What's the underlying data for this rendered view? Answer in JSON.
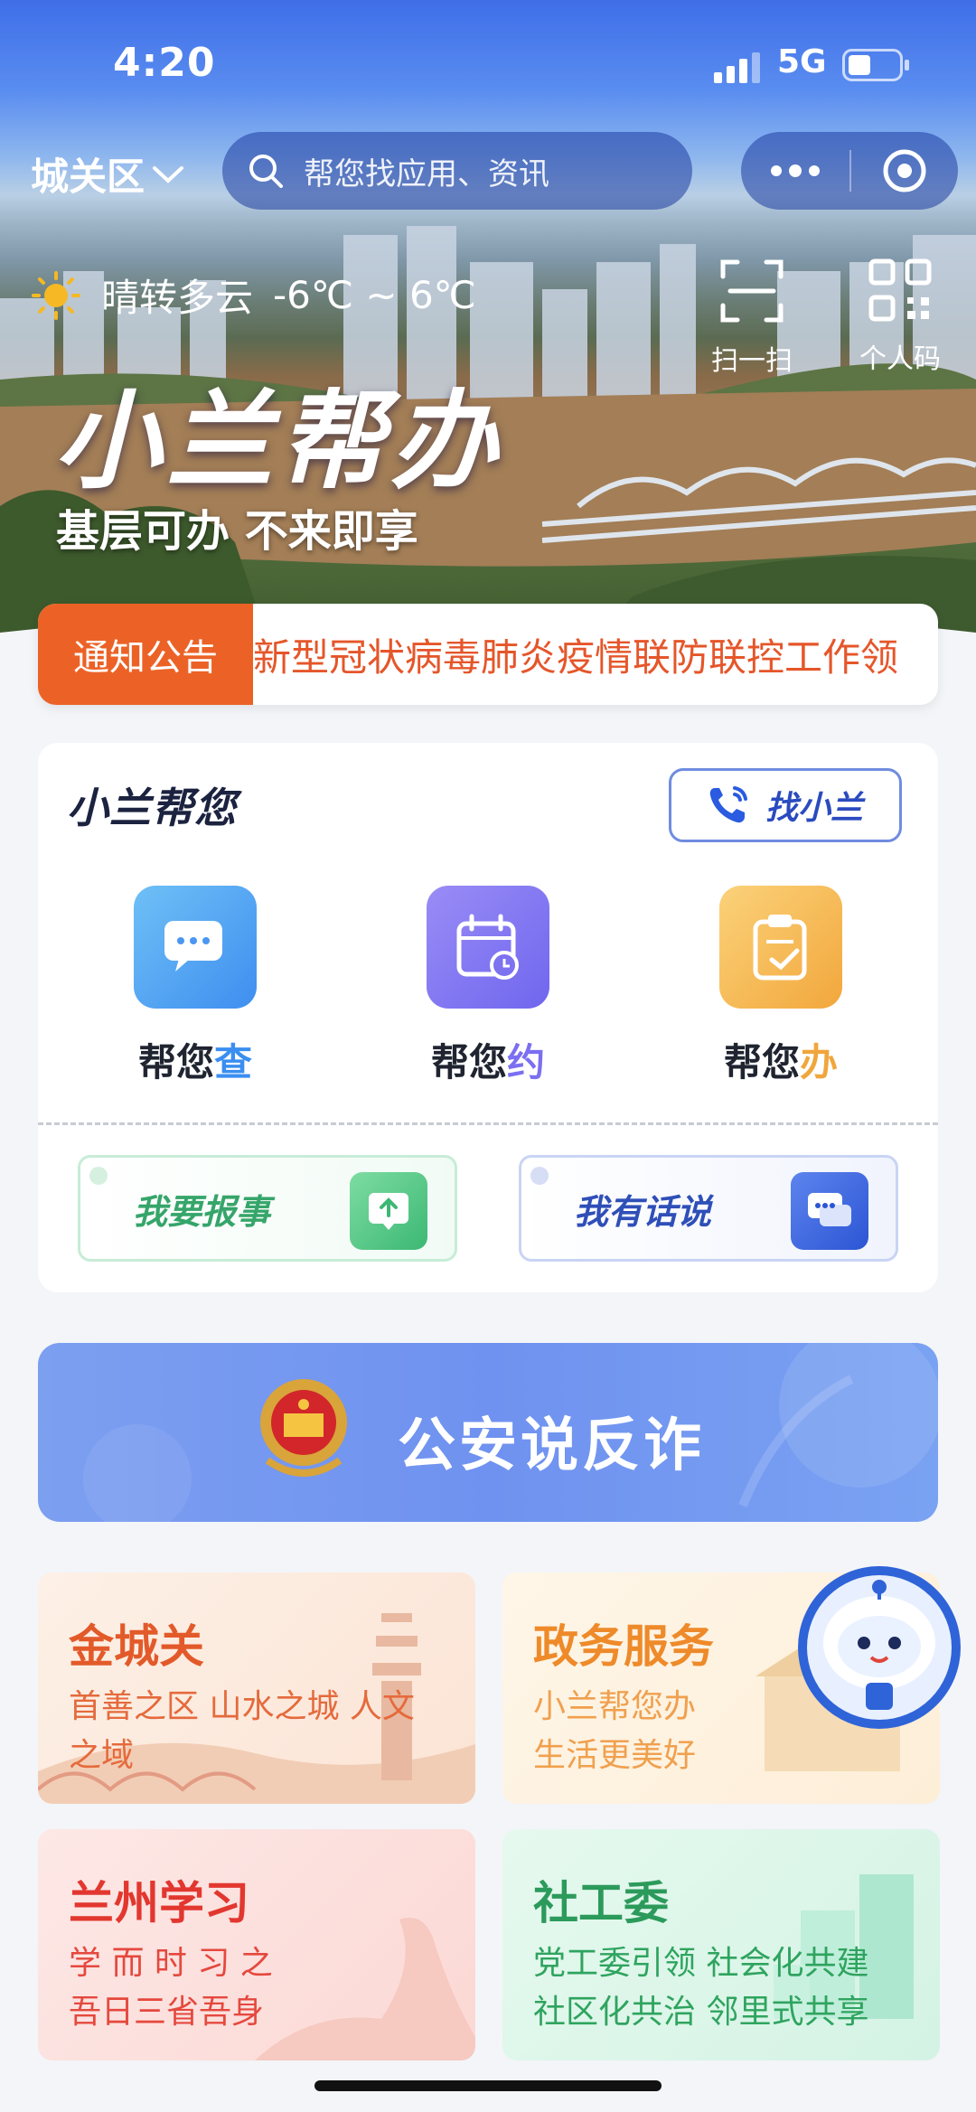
{
  "status": {
    "time": "4:20",
    "network": "5G"
  },
  "topbar": {
    "district": "城关区",
    "search_placeholder": "帮您找应用、资讯"
  },
  "weather": {
    "text": "晴转多云",
    "temperature": "-6℃ ~ 6℃"
  },
  "quick_actions": [
    {
      "label": "扫一扫",
      "icon": "scan-icon"
    },
    {
      "label": "个人码",
      "icon": "qrcode-icon"
    }
  ],
  "hero": {
    "slogan_title": "小兰帮办",
    "slogan_sub": "基层可办 不来即享"
  },
  "notice": {
    "tag": "通知公告",
    "text": "新型冠状病毒肺炎疫情联防联控工作领"
  },
  "help": {
    "title": "小兰帮您",
    "find_button": "找小兰",
    "services": [
      {
        "prefix": "帮您",
        "accent": "查",
        "accent_color": "#3a8ef0"
      },
      {
        "prefix": "帮您",
        "accent": "约",
        "accent_color": "#7b6ff2"
      },
      {
        "prefix": "帮您",
        "accent": "办",
        "accent_color": "#f0a63c"
      }
    ],
    "actions": [
      {
        "label": "我要报事",
        "icon": "upload-icon"
      },
      {
        "label": "我有话说",
        "icon": "chat-icon"
      }
    ]
  },
  "banner": {
    "text": "公安说反诈"
  },
  "tiles": [
    {
      "title": "金城关",
      "subtitle_line1": "首善之区 山水之城 人文",
      "subtitle_line2": "之域"
    },
    {
      "title": "政务服务",
      "subtitle_line1": "小兰帮您办",
      "subtitle_line2": "生活更美好"
    },
    {
      "title": "兰州学习",
      "subtitle_line1": "学 而 时 习 之",
      "subtitle_line2": "吾日三省吾身"
    },
    {
      "title": "社工委",
      "subtitle_line1": "党工委引领 社会化共建",
      "subtitle_line2": "社区化共治 邻里式共享"
    }
  ],
  "colors": {
    "notice_tag": "#ec6226",
    "notice_text": "#e5562a",
    "primary": "#2a4bbf"
  }
}
